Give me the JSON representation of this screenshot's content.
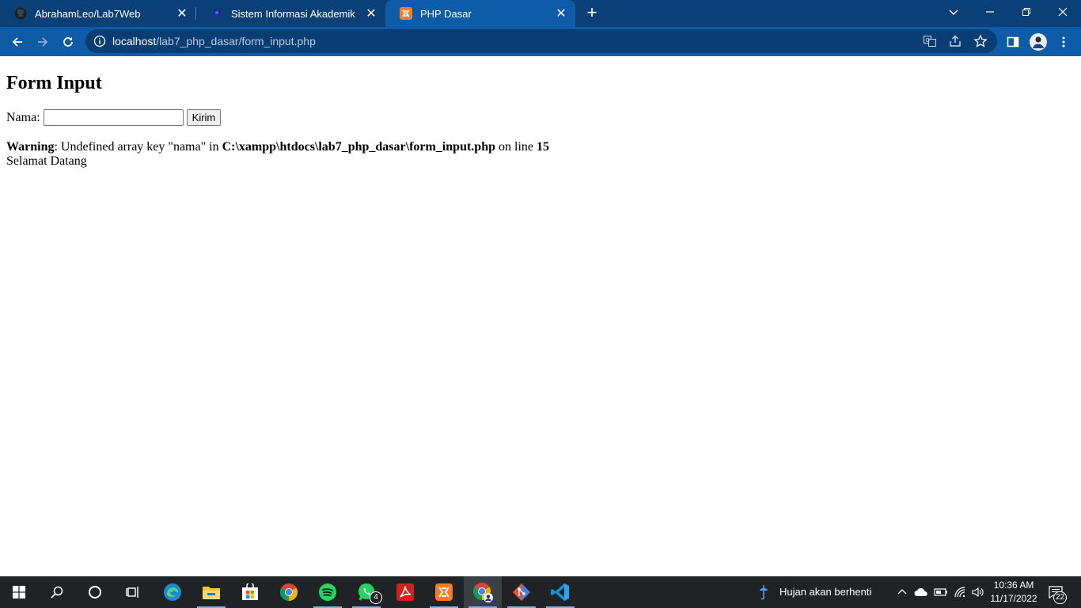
{
  "browser": {
    "tabs": [
      {
        "title": "AbrahamLeo/Lab7Web",
        "active": false,
        "icon": "github-icon"
      },
      {
        "title": "Sistem Informasi Akademik",
        "active": false,
        "icon": "campus-logo-icon"
      },
      {
        "title": "PHP Dasar",
        "active": true,
        "icon": "xampp-icon"
      }
    ],
    "address": {
      "host": "localhost",
      "path": "/lab7_php_dasar/form_input.php"
    },
    "colors": {
      "tabstrip": "#0b3f78",
      "toolbar": "#0e5ba8",
      "omnibox": "#0a3d74"
    }
  },
  "page": {
    "heading": "Form Input",
    "form": {
      "label": "Nama:",
      "input_value": "",
      "submit_label": "Kirim"
    },
    "warning": {
      "label": "Warning",
      "message": ": Undefined array key \"nama\" in ",
      "file": "C:\\xampp\\htdocs\\lab7_php_dasar\\form_input.php",
      "line_text": " on line ",
      "line": "15"
    },
    "greeting": "Selamat Datang"
  },
  "taskbar": {
    "weather": "Hujan akan berhenti",
    "time": "10:36 AM",
    "date": "11/17/2022",
    "whatsapp_badge": "4",
    "notifications_badge": "22",
    "apps": [
      "start-icon",
      "search-icon",
      "cortana-icon",
      "task-view-icon",
      "edge-icon",
      "file-explorer-icon",
      "store-icon",
      "chrome-icon",
      "spotify-icon",
      "whatsapp-icon",
      "acrobat-icon",
      "xampp-icon",
      "chrome-profile-icon",
      "git-icon",
      "vscode-icon"
    ]
  }
}
